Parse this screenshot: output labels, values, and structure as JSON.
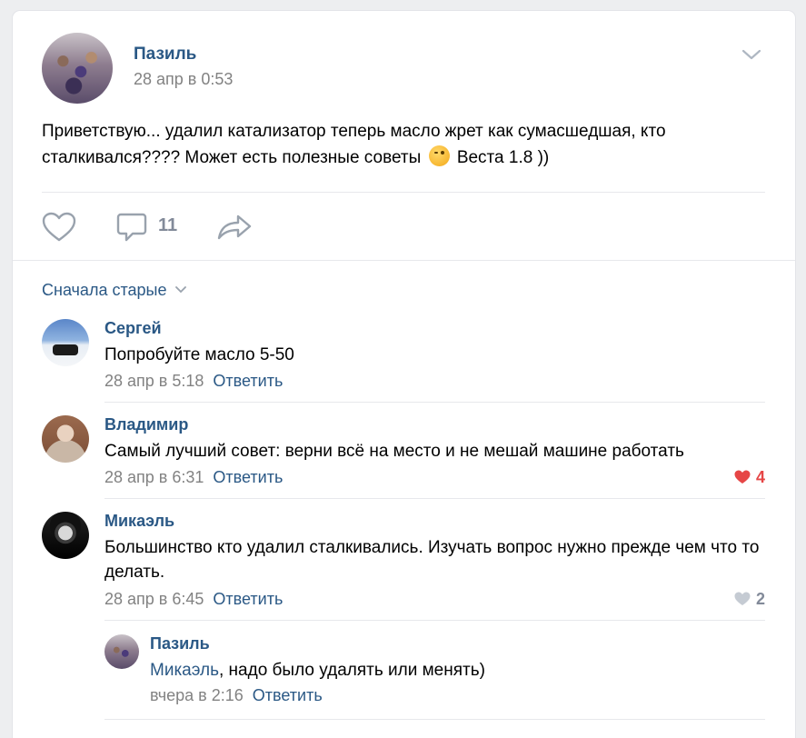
{
  "post": {
    "author": "Пазиль",
    "date": "28 апр в 0:53",
    "text": "Приветствую... удалил катализатор теперь масло жрет как сумасшедшая, кто сталкивался???? Может есть полезные советы",
    "text_after_emoji": "Веста 1.8 ))",
    "comment_count": "11"
  },
  "comments_sort": "Сначала старые",
  "comments": [
    {
      "name": "Сергей",
      "text": "Попробуйте масло 5-50",
      "date": "28 апр в 5:18",
      "reply": "Ответить",
      "likes": ""
    },
    {
      "name": "Владимир",
      "text": "Самый лучший совет: верни всё на место и не мешай машине работать",
      "date": "28 апр в 6:31",
      "reply": "Ответить",
      "likes": "4"
    },
    {
      "name": "Микаэль",
      "text": "Большинство кто удалил сталкивались. Изучать вопрос нужно прежде чем что то делать.",
      "date": "28 апр в 6:45",
      "reply": "Ответить",
      "likes": "2"
    }
  ],
  "reply_comment": {
    "name": "Пазиль",
    "mention": "Микаэль",
    "text": ", надо было удалять или менять)",
    "date": "вчера в 2:16",
    "reply": "Ответить"
  },
  "colors": {
    "link": "#2a5885",
    "meta": "#828282",
    "like_active": "#e64646",
    "icon": "#99a2ad"
  },
  "icons": [
    "chevron-down-icon",
    "heart-icon",
    "comment-icon",
    "share-icon",
    "emoji-wink-icon"
  ]
}
